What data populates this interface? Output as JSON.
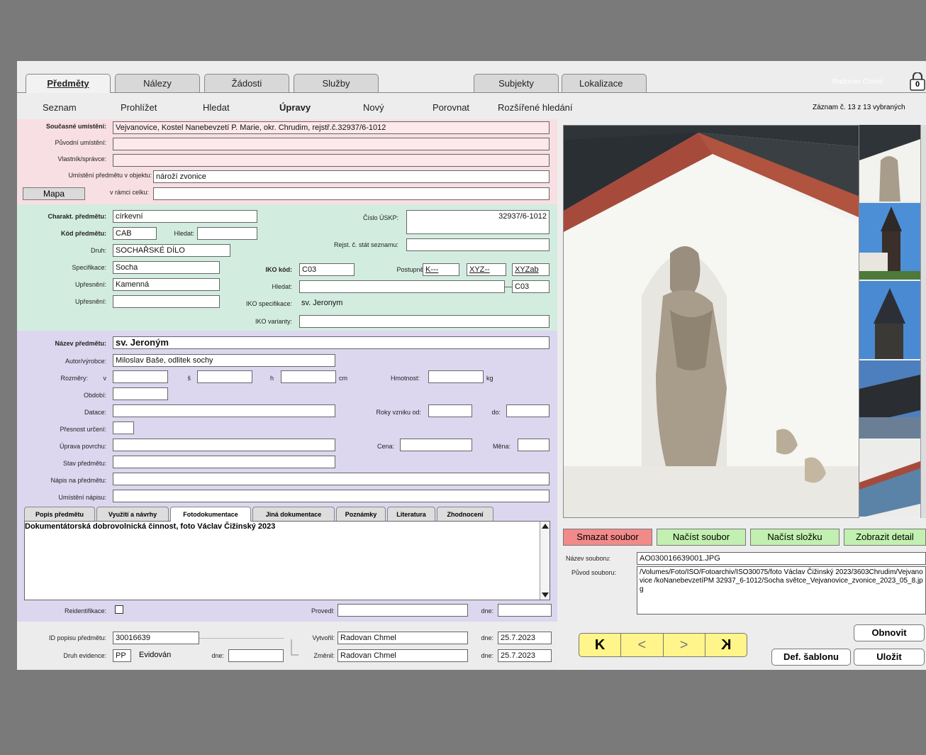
{
  "tabs": {
    "predmety": "Předměty",
    "nalezy": "Nálezy",
    "zadosti": "Žádosti",
    "sluzby": "Služby",
    "subjekty": "Subjekty",
    "lokalizace": "Lokalizace"
  },
  "user": "Radovan Chmel",
  "lock_count": "0",
  "nav": {
    "seznam": "Seznam",
    "prohlizet": "Prohlížet",
    "hledat": "Hledat",
    "upravy": "Úpravy",
    "novy": "Nový",
    "porovnat": "Porovnat",
    "rozsirene": "Rozšířené hledání"
  },
  "record_info": "Záznam č. 13 z 13 vybraných",
  "location": {
    "soucasne_label": "Současné umístění:",
    "soucasne_value": "Vejvanovice, Kostel Nanebevzetí P. Marie, okr. Chrudim, rejstř.č.32937/6-1012",
    "puvodni_label": "Původní umístění:",
    "puvodni_value": "",
    "vlastnik_label": "Vlastník/správce:",
    "vlastnik_value": "",
    "umisteni_label": "Umístění předmětu v objektu:",
    "umisteni_value": "nároží zvonice",
    "mapa_button": "Mapa",
    "ramci_label": "v rámci celku:",
    "ramci_value": ""
  },
  "charakt": {
    "charakt_label": "Charakt. předmětu:",
    "charakt_value": "církevní",
    "kod_label": "Kód předmětu:",
    "kod_value": "CAB",
    "hledat_label": "Hledat:",
    "hledat_value": "",
    "druh_label": "Druh:",
    "druh_value": "SOCHAŘSKÉ DÍLO",
    "spec_label": "Specifikace:",
    "spec_value": "Socha",
    "upr1_label": "Upřesnění:",
    "upr1_value": "Kamenná",
    "upr2_label": "Upřesnění:",
    "upr2_value": "",
    "uskp_label": "Číslo ÚSKP:",
    "uskp_value": "32937/6-1012",
    "rejst_label": "Rejst. č. stát seznamu:",
    "rejst_value": "",
    "iko_label": "IKO kód:",
    "iko_value": "C03",
    "postupne_label": "Postupně:",
    "post1": "K---",
    "post2": "XYZ--",
    "post3": "XYZab",
    "iko_hledat_label": "Hledat:",
    "iko_hledat_value": "",
    "iko_hledat_result": "C03",
    "iko_spec_label": "IKO specifikace:",
    "iko_spec_value": "sv. Jeronym",
    "iko_var_label": "IKO varianty:",
    "iko_var_value": ""
  },
  "detail": {
    "nazev_label": "Název předmětu:",
    "nazev_value": "sv. Jeroným",
    "autor_label": "Autor/výrobce:",
    "autor_value": "Miloslav Baše, odlitek sochy",
    "rozmery_label": "Rozměry:",
    "v_label": "v",
    "s_label": "š",
    "h_label": "h",
    "cm_label": "cm",
    "hmotnost_label": "Hmotnost:",
    "kg_label": "kg",
    "obdobi_label": "Období:",
    "datace_label": "Datace:",
    "roky_label": "Roky vzniku od:",
    "do_label": "do:",
    "presnost_label": "Přesnost určení:",
    "uprava_label": "Úprava povrchu:",
    "cena_label": "Cena:",
    "mena_label": "Měna:",
    "stav_label": "Stav předmětu:",
    "napis_label": "Nápis na předmětu:",
    "umisteni_napisu_label": "Umístění nápisu:"
  },
  "subtabs": {
    "popis": "Popis předmětu",
    "vyuziti": "Využití a návrhy",
    "foto": "Fotodokumentace",
    "jina": "Jiná dokumentace",
    "poznamky": "Poznámky",
    "literatura": "Literatura",
    "zhodnoceni": "Zhodnocení"
  },
  "foto_text": "Dokumentátorská dobrovolnická činnost, foto Václav Čižinský 2023",
  "reident": {
    "label": "Reidentifikace:",
    "provedl_label": "Provedl:",
    "provedl_value": "",
    "dne_label": "dne:",
    "dne_value": ""
  },
  "footer": {
    "id_label": "ID popisu předmětu:",
    "id_value": "30016639",
    "druh_label": "Druh evidence:",
    "druh_code": "PP",
    "druh_text": "Evidován",
    "dne_label": "dne:",
    "dne_value": "",
    "vytvoril_label": "Vytvořil:",
    "vytvoril_value": "Radovan Chmel",
    "vytvoril_dne_label": "dne:",
    "vytvoril_dne_value": "25.7.2023",
    "zmenil_label": "Změnil:",
    "zmenil_value": "Radovan Chmel",
    "zmenil_dne_label": "dne:",
    "zmenil_dne_value": "25.7.2023"
  },
  "image_buttons": {
    "smazat": "Smazat soubor",
    "nacist": "Načíst soubor",
    "slozka": "Načíst složku",
    "detail": "Zobrazit detail"
  },
  "file": {
    "nazev_label": "Název souboru:",
    "nazev_value": "AO030016639001.JPG",
    "puvod_label": "Původ souboru:",
    "puvod_value": "/Volumes/Foto/ISO/Fotoarchiv/ISO30075/foto Václav Čižinský 2023/3603Chrudim/Vejvanovice /koNanebevzetíPM 32937_6-1012/Socha světce_Vejvanovice_zvonice_2023_05_8.jpg"
  },
  "pager": {
    "first": "K",
    "prev": "<",
    "next": ">",
    "last": "K"
  },
  "actions": {
    "obnovit": "Obnovit",
    "def": "Def. šablonu",
    "ulozit": "Uložit"
  },
  "colors": {
    "pink": "#f7dfe3",
    "green": "#d3ece0",
    "lavender": "#dcd7ef",
    "btn_red": "#f28a8a",
    "btn_green": "#c2f0b0",
    "pager_yellow": "#fff58a"
  }
}
